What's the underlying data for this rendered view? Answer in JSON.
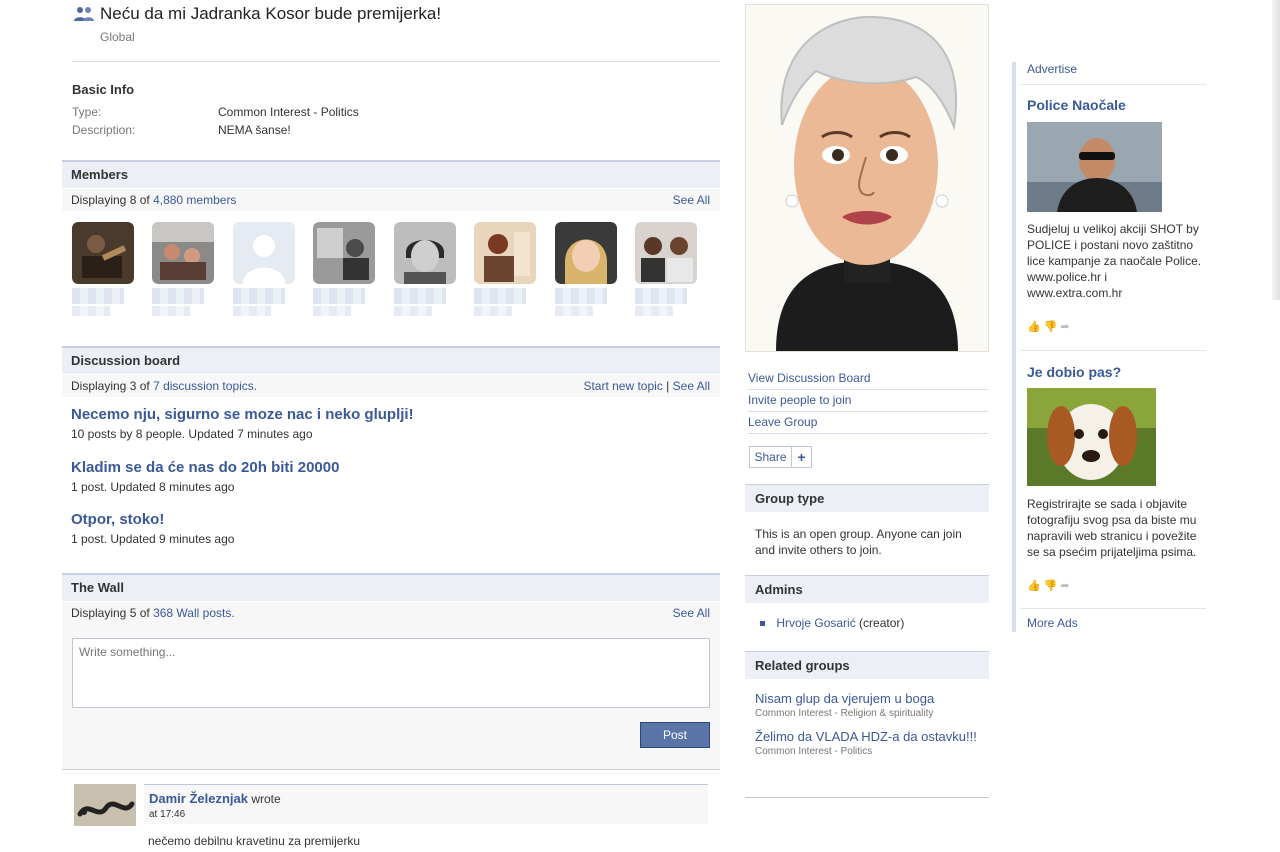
{
  "group": {
    "title": "Neću da mi Jadranka Kosor bude premijerka!",
    "scope": "Global"
  },
  "basic_info": {
    "heading": "Basic Info",
    "type_label": "Type:",
    "type_value": "Common Interest - Politics",
    "description_label": "Description:",
    "description_value": "NEMA šanse!"
  },
  "members": {
    "heading": "Members",
    "display_prefix": "Displaying 8 of",
    "count_link": "4,880 members",
    "see_all": "See All"
  },
  "discussion": {
    "heading": "Discussion board",
    "display_prefix": "Displaying 3 of",
    "count_link": "7 discussion topics.",
    "start_new": "Start new topic",
    "separator": "|",
    "see_all": "See All",
    "topics": [
      {
        "title": "Necemo nju, sigurno se moze nac i neko gluplji!",
        "meta": "10 posts by 8 people. Updated 7 minutes ago"
      },
      {
        "title": "Kladim se da će nas do 20h biti 20000",
        "meta": "1 post. Updated 8 minutes ago"
      },
      {
        "title": "Otpor, stoko!",
        "meta": "1 post. Updated 9 minutes ago"
      }
    ]
  },
  "wall": {
    "heading": "The Wall",
    "display_prefix": "Displaying 5 of",
    "count_link": "368 Wall posts.",
    "see_all": "See All",
    "placeholder": "Write something...",
    "post_label": "Post",
    "posts": [
      {
        "author": "Damir Železnjak",
        "wrote": "wrote",
        "time": "at 17:46",
        "text": "nečemo debilnu kravetinu za premijerku"
      }
    ]
  },
  "sidebar": {
    "view_board": "View Discussion Board",
    "invite": "Invite people to join",
    "leave": "Leave Group",
    "share": "Share",
    "share_plus": "+",
    "group_type_heading": "Group type",
    "group_type_text": "This is an open group. Anyone can join and invite others to join.",
    "admins_heading": "Admins",
    "admin_name": "Hrvoje Gosarić",
    "admin_role": "(creator)",
    "related_heading": "Related groups",
    "related": [
      {
        "name": "Nisam glup da vjerujem u boga",
        "category": "Common Interest - Religion & spirituality"
      },
      {
        "name": "Želimo da VLADA HDZ-a da ostavku!!!",
        "category": "Common Interest - Politics"
      }
    ]
  },
  "ads": {
    "advertise": "Advertise",
    "items": [
      {
        "title": "Police Naočale",
        "text": "Sudjeluj u velikoj akciji SHOT by POLICE i postani novo zaštitno lice kampanje za naočale Police. www.police.hr i www.extra.com.hr"
      },
      {
        "title": "Je dobio pas?",
        "text": "Registrirajte se sada i objavite fotografiju svog psa da biste mu napravili web stranicu i povežite se sa psećim prijateljima psima."
      }
    ],
    "more": "More Ads"
  },
  "colors": {
    "link": "#3b5998",
    "section_bg": "#eceff5",
    "button_bg": "#5b74a8"
  }
}
